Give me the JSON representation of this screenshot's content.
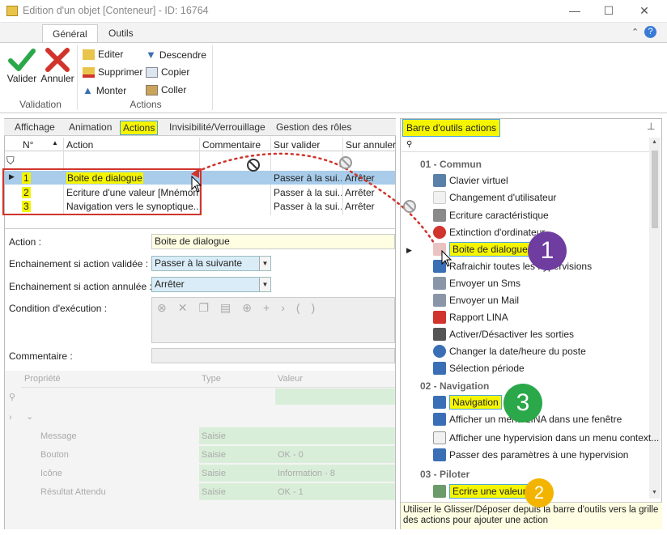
{
  "window": {
    "title": "Edition d'un objet [Conteneur] - ID: 16764",
    "min": "—",
    "max": "☐",
    "close": "✕"
  },
  "ribbon": {
    "tabs": [
      {
        "label": "Général"
      },
      {
        "label": "Outils"
      }
    ],
    "validation": {
      "validate": "Valider",
      "cancel": "Annuler",
      "group": "Validation"
    },
    "actions": {
      "edit": "Editer",
      "delete": "Supprimer",
      "up": "Monter",
      "down": "Descendre",
      "copy": "Copier",
      "paste": "Coller",
      "group": "Actions"
    }
  },
  "left": {
    "tabs": [
      "Affichage",
      "Animation",
      "Actions",
      "Invisibilité/Verrouillage",
      "Gestion des rôles"
    ],
    "grid": {
      "columns": [
        "N°",
        "Action",
        "Commentaire",
        "Sur valider",
        "Sur annuler"
      ],
      "rows": [
        {
          "n": "1",
          "action": "Boite de dialogue",
          "valider": "Passer à la sui...",
          "annuler": "Arrêter"
        },
        {
          "n": "2",
          "action": "Ecriture d'une valeur [Mnémon...",
          "valider": "Passer à la sui...",
          "annuler": "Arrêter"
        },
        {
          "n": "3",
          "action": "Navigation vers le synoptique...",
          "valider": "Passer à la sui...",
          "annuler": "Arrêter"
        }
      ]
    },
    "form": {
      "action_label": "Action :",
      "action_value": "Boite de dialogue",
      "valid_label": "Enchainement si action validée :",
      "valid_value": "Passer à la suivante",
      "cancel_label": "Enchainement si action annulée :",
      "cancel_value": "Arrêter",
      "condition_label": "Condition d'exécution :",
      "comment_label": "Commentaire :"
    },
    "props": {
      "columns": [
        "Propriété",
        "Type",
        "Valeur"
      ],
      "rows": [
        {
          "name": "Message",
          "type": "Saisie",
          "value": ""
        },
        {
          "name": "Bouton",
          "type": "Saisie",
          "value": "OK - 0"
        },
        {
          "name": "Icône",
          "type": "Saisie",
          "value": "Information - 8"
        },
        {
          "name": "Résultat Attendu",
          "type": "Saisie",
          "value": "OK - 1"
        }
      ]
    }
  },
  "right": {
    "title": "Barre d'outils actions",
    "sections": [
      {
        "name": "01 - Commun",
        "items": [
          "Clavier virtuel",
          "Changement d'utilisateur",
          "Ecriture caractéristique",
          "Extinction d'ordinateur",
          "Boite de dialogue",
          "Rafraichir toutes les hypervisions",
          "Envoyer un Sms",
          "Envoyer un Mail",
          "Rapport LINA",
          "Activer/Désactiver les sorties",
          "Changer la date/heure du poste",
          "Sélection période"
        ]
      },
      {
        "name": "02 - Navigation",
        "items": [
          "Navigation",
          "Afficher un menu LINA dans une fenêtre",
          "Afficher une hypervision dans un menu context...",
          "Passer des paramètres à une hypervision"
        ]
      },
      {
        "name": "03 - Piloter",
        "items": [
          "Ecrire une valeur"
        ]
      }
    ],
    "hint": "Utiliser le Glisser/Déposer depuis la barre d'outils vers la grille des actions pour ajouter une action"
  },
  "badges": [
    "1",
    "2",
    "3"
  ],
  "colors": {
    "highlight": "#f5f500",
    "green": "#2aa84a",
    "purple": "#6f3ca0",
    "orange": "#f3b400",
    "red": "#d0342c"
  }
}
